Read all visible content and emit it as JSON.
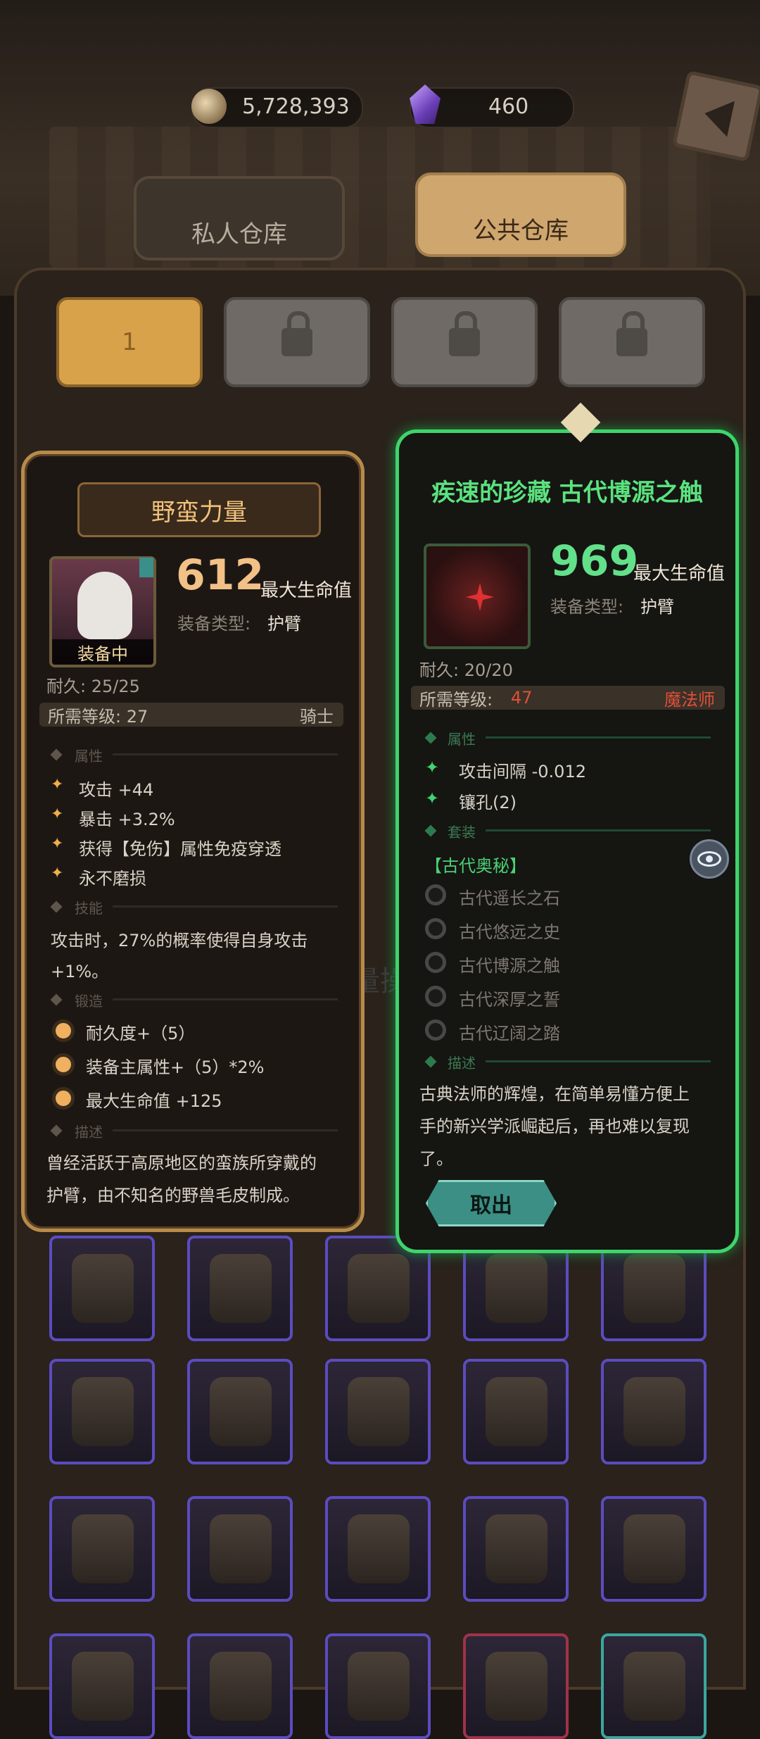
{
  "currency": {
    "coins": "5,728,393",
    "gems": "460"
  },
  "tabs": {
    "private": "私人仓库",
    "public": "公共仓库"
  },
  "warehouse_slot_1": "1",
  "background_hint": "批量操作",
  "left_card": {
    "title": "野蛮力量",
    "value": "612",
    "value_label": "最大生命值",
    "type_label": "装备类型:",
    "type_value": "护臂",
    "equipped": "装备中",
    "durability": "耐久: 25/25",
    "level_req": "所需等级: 27",
    "class": "骑士",
    "attr_head": "属性",
    "attrs": [
      "攻击 +44",
      "暴击 +3.2%",
      "获得【免伤】属性免疫穿透",
      "永不磨损"
    ],
    "skill_head": "技能",
    "skill_line1": "攻击时，27%的概率使得自身攻击",
    "skill_line2": "+1%。",
    "forge_head": "锻造",
    "forge": [
      "耐久度+（5）",
      "装备主属性+（5）*2%",
      "最大生命值 +125"
    ],
    "desc_head": "描述",
    "desc_line1": "曾经活跃于高原地区的蛮族所穿戴的",
    "desc_line2": "护臂，由不知名的野兽毛皮制成。"
  },
  "right_card": {
    "title": "疾速的珍藏 古代博源之触",
    "value": "969",
    "value_label": "最大生命值",
    "type_label": "装备类型:",
    "type_value": "护臂",
    "durability": "耐久: 20/20",
    "level_label": "所需等级:",
    "level_value": "47",
    "class": "魔法师",
    "attr_head": "属性",
    "attrs": [
      "攻击间隔 -0.012",
      "镶孔(2)"
    ],
    "set_head": "套装",
    "set_name": "【古代奥秘】",
    "set_items": [
      "古代遥长之石",
      "古代悠远之史",
      "古代博源之触",
      "古代深厚之誓",
      "古代辽阔之踏"
    ],
    "desc_head": "描述",
    "desc_line1": "古典法师的辉煌，在简单易懂方便上",
    "desc_line2": "手的新兴学派崛起后，再也难以复现",
    "desc_line3": "了。",
    "take_out": "取出"
  },
  "colors": {
    "gold": "#f0b048",
    "green": "#3fd46c",
    "red_text": "#e0503a",
    "slot_border": "#5b4cc0"
  }
}
